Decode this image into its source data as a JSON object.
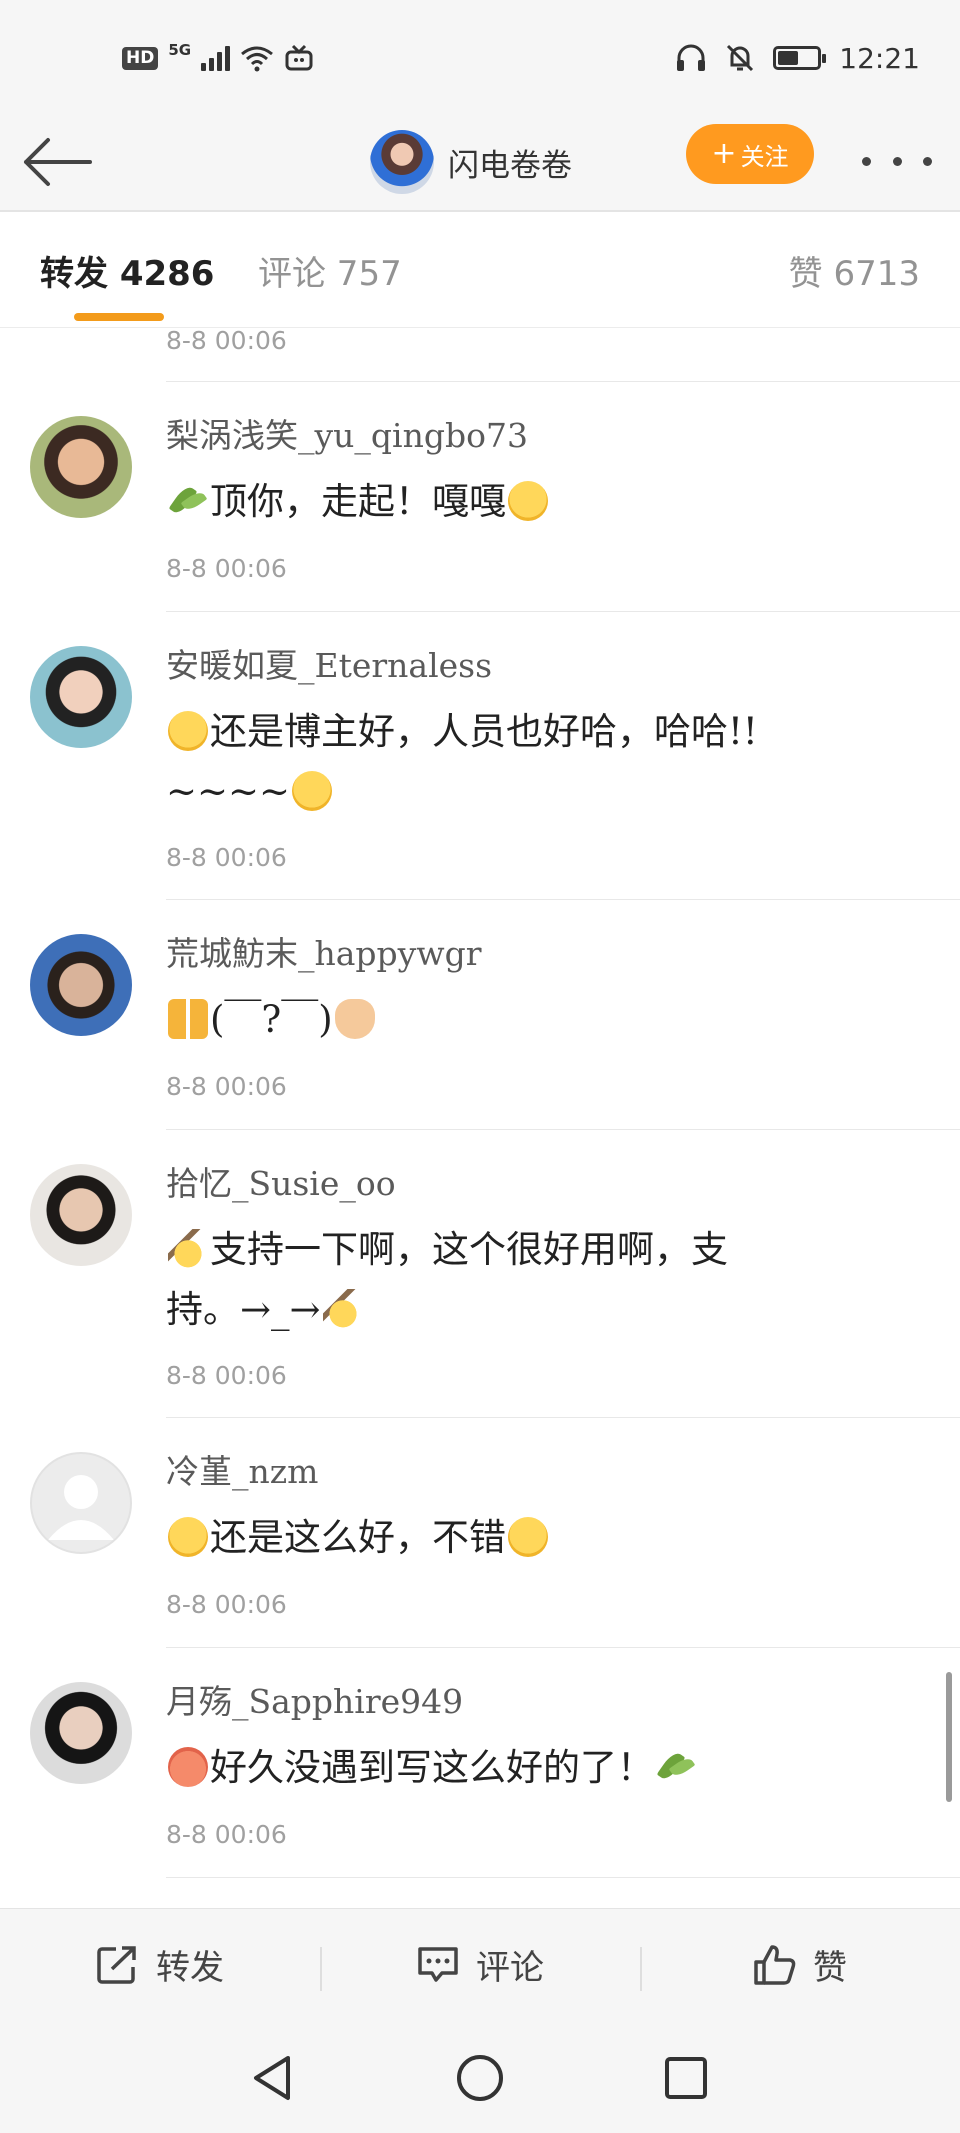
{
  "status_bar": {
    "hd": "HD",
    "network": "5G",
    "time": "12:21",
    "icons": [
      "hd-icon",
      "signal-icon",
      "wifi-icon",
      "tv-icon",
      "headphones-icon",
      "mute-bell-icon",
      "battery-icon"
    ]
  },
  "nav": {
    "back_icon": "back-arrow-icon",
    "author_name": "闪电卷卷",
    "follow_label": "关注",
    "follow_plus": "+",
    "more_icon": "more-dots-icon",
    "accent": "#ff9a1f"
  },
  "tabs": {
    "repost": "转发 4286",
    "comments": "评论 757",
    "likes": "赞 6713",
    "active": "repost",
    "indicator_color": "#f39b1b"
  },
  "feed": {
    "partial_time": "8-8 00:06",
    "items": [
      {
        "name": "梨涡浅笑_yu_qingbo73",
        "text_1": "顶你，走起！嘎嘎",
        "time": "8-8 00:06"
      },
      {
        "name": "安暖如夏_Eternaless",
        "text_1": "还是博主好，人员也好哈，哈哈!!",
        "text_2": "~~~~",
        "time": "8-8 00:06"
      },
      {
        "name": "荒城魴末_happywgr",
        "text_1": "(￣?￣)",
        "time": "8-8 00:06"
      },
      {
        "name": "拾忆_Susie_oo",
        "text_1": "支持一下啊，这个很好用啊，支",
        "text_2": "持。→_→",
        "time": "8-8 00:06"
      },
      {
        "name": "冷堇_nzm",
        "text_1": "还是这么好，不错",
        "time": "8-8 00:06"
      },
      {
        "name": "月殇_Sapphire949",
        "text_1": "好久没遇到写这么好的了！",
        "time": "8-8 00:06"
      }
    ]
  },
  "bottom_bar": {
    "repost": "转发",
    "comment": "评论",
    "like": "赞"
  },
  "system_nav": {
    "back": "triangle-back-icon",
    "home": "circle-home-icon",
    "recents": "square-recents-icon"
  }
}
